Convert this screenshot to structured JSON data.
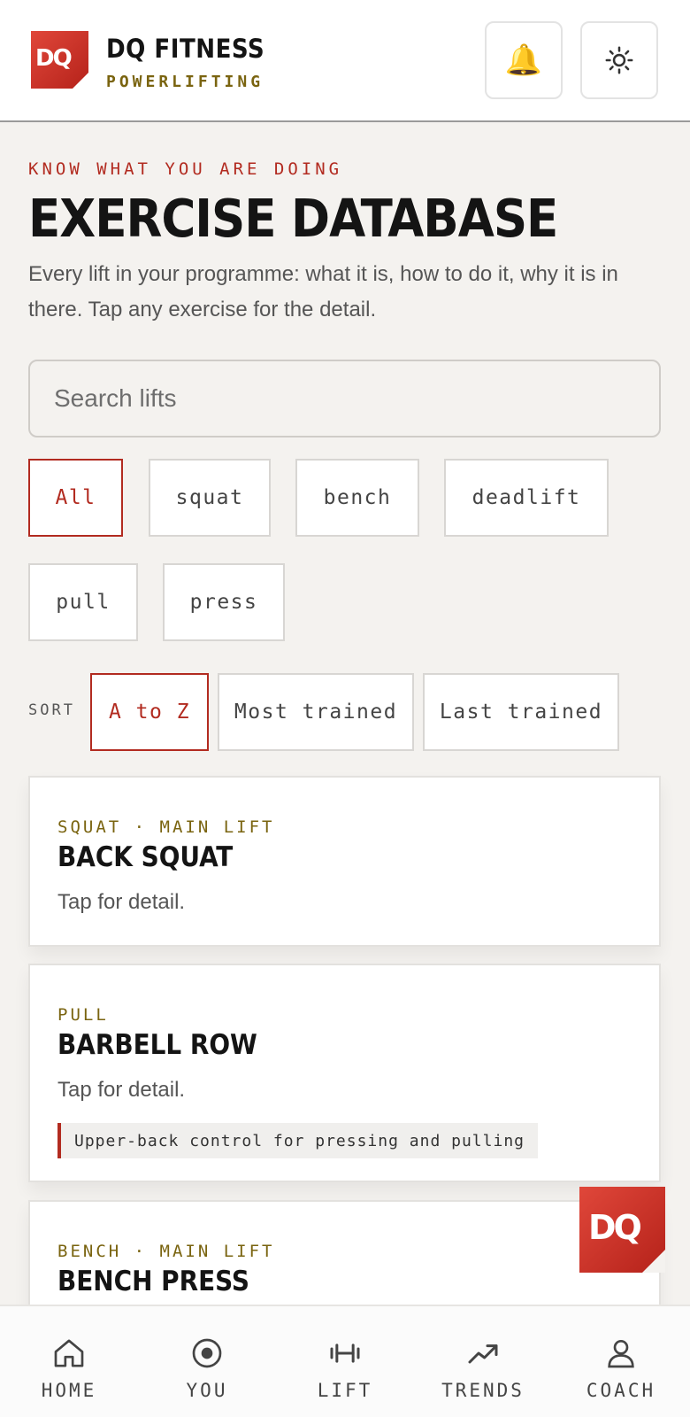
{
  "header": {
    "logo_text": "DQ",
    "brand": "DQ FITNESS",
    "subtitle": "POWERLIFTING",
    "bell_icon": "bell-icon",
    "theme_icon": "sun-icon"
  },
  "intro": {
    "kicker": "KNOW WHAT YOU ARE DOING",
    "title": "EXERCISE DATABASE",
    "description": "Every lift in your programme: what it is, how to do it, why it is in there. Tap any exercise for the detail."
  },
  "search": {
    "placeholder": "Search lifts",
    "value": ""
  },
  "filters": {
    "active": "All",
    "items": [
      "All",
      "squat",
      "bench",
      "deadlift",
      "pull",
      "press"
    ]
  },
  "sort": {
    "label": "SORT",
    "active": "A to Z",
    "options": [
      "A to Z",
      "Most trained",
      "Last trained"
    ]
  },
  "exercises": [
    {
      "meta": "SQUAT · MAIN LIFT",
      "name": "BACK SQUAT",
      "tap": "Tap for detail."
    },
    {
      "meta": "PULL",
      "name": "BARBELL ROW",
      "tap": "Tap for detail.",
      "note": "Upper-back control for pressing and pulling"
    },
    {
      "meta": "BENCH · MAIN LIFT",
      "name": "BENCH PRESS"
    }
  ],
  "fab": {
    "label": "DQ"
  },
  "nav": [
    {
      "label": "HOME",
      "icon": "home-icon"
    },
    {
      "label": "YOU",
      "icon": "target-icon"
    },
    {
      "label": "LIFT",
      "icon": "dumbbell-icon"
    },
    {
      "label": "TRENDS",
      "icon": "trend-icon"
    },
    {
      "label": "COACH",
      "icon": "user-icon"
    }
  ],
  "colors": {
    "accent": "#b22b20",
    "gold": "#7a6410",
    "background": "#f4f2ef"
  }
}
